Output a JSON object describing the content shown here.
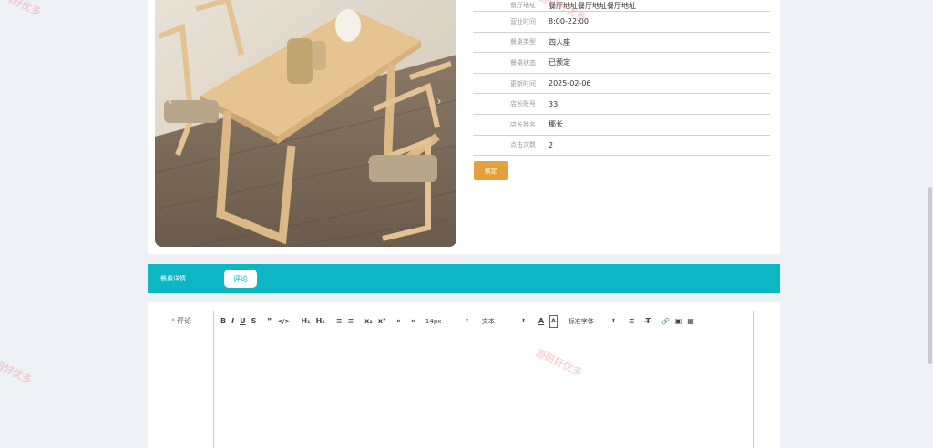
{
  "info_rows": [
    {
      "key": "餐厅地址",
      "value": "餐厅地址餐厅地址餐厅地址"
    },
    {
      "key": "营业时间",
      "value": "8:00-22:00"
    },
    {
      "key": "餐桌类型",
      "value": "四人座"
    },
    {
      "key": "餐桌状态",
      "value": "已预定"
    },
    {
      "key": "更新时间",
      "value": "2025-02-06"
    },
    {
      "key": "店长账号",
      "value": "33"
    },
    {
      "key": "店长姓名",
      "value": "椰长"
    },
    {
      "key": "点击次数",
      "value": "2"
    }
  ],
  "book_button": "预定",
  "tabs": {
    "detail": "餐桌详情",
    "comment": "评论"
  },
  "form": {
    "label": "评论",
    "required_mark": "*"
  },
  "toolbar": {
    "bold": "B",
    "italic": "I",
    "underline": "U",
    "strike": "S",
    "quote": "❞",
    "code": "</>",
    "h1": "H₁",
    "h2": "H₂",
    "ol": "≡",
    "ul": "≡",
    "sub": "x₂",
    "sup": "x²",
    "indent_out": "⇤",
    "indent_in": "⇥",
    "size": "14px",
    "type": "文本",
    "font": "标准字体",
    "color": "A",
    "bg": "A",
    "align": "≡",
    "clear": "T̶",
    "link": "🔗",
    "image": "▣",
    "video": "▦"
  },
  "watermark": "源码好优多",
  "carousel": {
    "prev": "‹",
    "next": "›"
  },
  "colors": {
    "accent": "#0cb7c3",
    "button": "#e4a03a",
    "required": "#f56c6c"
  }
}
